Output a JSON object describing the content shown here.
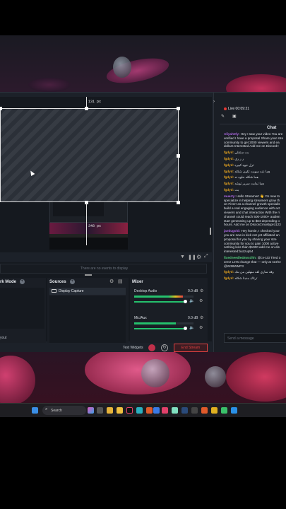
{
  "preview": {
    "top_measure": "131 px",
    "bottom_measure": "348 px"
  },
  "dock": {
    "no_events_text": "There are no events to display",
    "scenes_title": "rk Mode",
    "sources_title": "Sources",
    "source_item": "Display Capture",
    "mixer_title": "Mixer",
    "mixer_channels": [
      {
        "name": "Desktop Audio",
        "db": "0.0 dB",
        "level": 0.82
      },
      {
        "name": "Mic/Aux",
        "db": "0.0 dB",
        "level": 0.7
      }
    ],
    "scene_side_text": "yout"
  },
  "bottom_bar": {
    "test_widgets_label": "Test Widgets",
    "end_stream_label": "End Stream"
  },
  "live": {
    "status": "Live 00:09:21"
  },
  "chat": {
    "title": "Chat",
    "input_placeholder": "Send a message",
    "messages": [
      {
        "user": "Aliyahtrly:",
        "text": "Hey I saw your video You are",
        "color": "v"
      },
      {
        "user": "",
        "text": "verified I have a proposal Share your stre",
        "color": "v"
      },
      {
        "user": "",
        "text": "community to get 2000 viewers and ea",
        "color": "v"
      },
      {
        "user": "",
        "text": "dollars Interested Add me on Discord> ",
        "color": "v"
      },
      {
        "user": "fgdyd:",
        "text": "بت ستقلي",
        "color": "o"
      },
      {
        "user": "fgdyd:",
        "text": "ر ر ري",
        "color": "o"
      },
      {
        "user": "fgdyd:",
        "text": "ترل جوه كبيره",
        "color": "o"
      },
      {
        "user": "fgdyd:",
        "text": "هما عنه سويت تكون شكله",
        "color": "o"
      },
      {
        "user": "fgdyd:",
        "text": "هما شكله حلوه نه",
        "color": "o"
      },
      {
        "user": "fgdyd:",
        "text": "هما تمايت سرير توشه",
        "color": "o"
      },
      {
        "user": "fgdyd:",
        "text": "بت",
        "color": "o"
      },
      {
        "user": "muerty:",
        "text": "Hello Streamer! 👋 I'm new to",
        "color": "v"
      },
      {
        "user": "",
        "text": "specialize in helping streamers grow th",
        "color": "v"
      },
      {
        "user": "",
        "text": "on Fiverr as a channel growth specialis",
        "color": "v"
      },
      {
        "user": "",
        "text": "build a real engaging audience with act",
        "color": "v"
      },
      {
        "user": "",
        "text": "viewers and chat interaction With the ri",
        "color": "v"
      },
      {
        "user": "",
        "text": "channel could reach 500-1000+ audien",
        "color": "v"
      },
      {
        "user": "",
        "text": "start generating up to $64 depending o",
        "color": "v"
      },
      {
        "user": "",
        "text": "hours. Add me on Discord:mustypro123",
        "color": "v"
      },
      {
        "user": "jamlugold:",
        "text": "Hey homie, I checked your",
        "color": "v"
      },
      {
        "user": "",
        "text": "you are new in kick not yet affiliated an",
        "color": "v"
      },
      {
        "user": "",
        "text": "proposal for you by sharing your stre",
        "color": "v"
      },
      {
        "user": "",
        "text": "community for you to gain 1000 active",
        "color": "v"
      },
      {
        "user": "",
        "text": "nothing less than $1000 add me on dis",
        "color": "v"
      },
      {
        "user": "",
        "text": "interested:buzzup54",
        "color": "v"
      },
      {
        "user": "fixedneedle4kwcdhh:",
        "text": "@cv-1t3 Tired o",
        "color": "g"
      },
      {
        "user": "",
        "text": "zero! Let's change that — only at nezhe",
        "color": "g"
      },
      {
        "user": "",
        "text": "@W38WMP3",
        "color": "g"
      },
      {
        "user": "fgdyd:",
        "text": "وقه ساري لقه منهلين من بنك",
        "color": "o"
      },
      {
        "user": "fgdyd:",
        "text": "ترتاك مندنا شكله",
        "color": "o"
      }
    ]
  },
  "taskbar": {
    "search_label": "Search"
  },
  "colors": {
    "accent_green": "#25c06d",
    "live_red": "#e53935",
    "end_stream": "#e04040",
    "panel_bg": "#1c2129"
  }
}
